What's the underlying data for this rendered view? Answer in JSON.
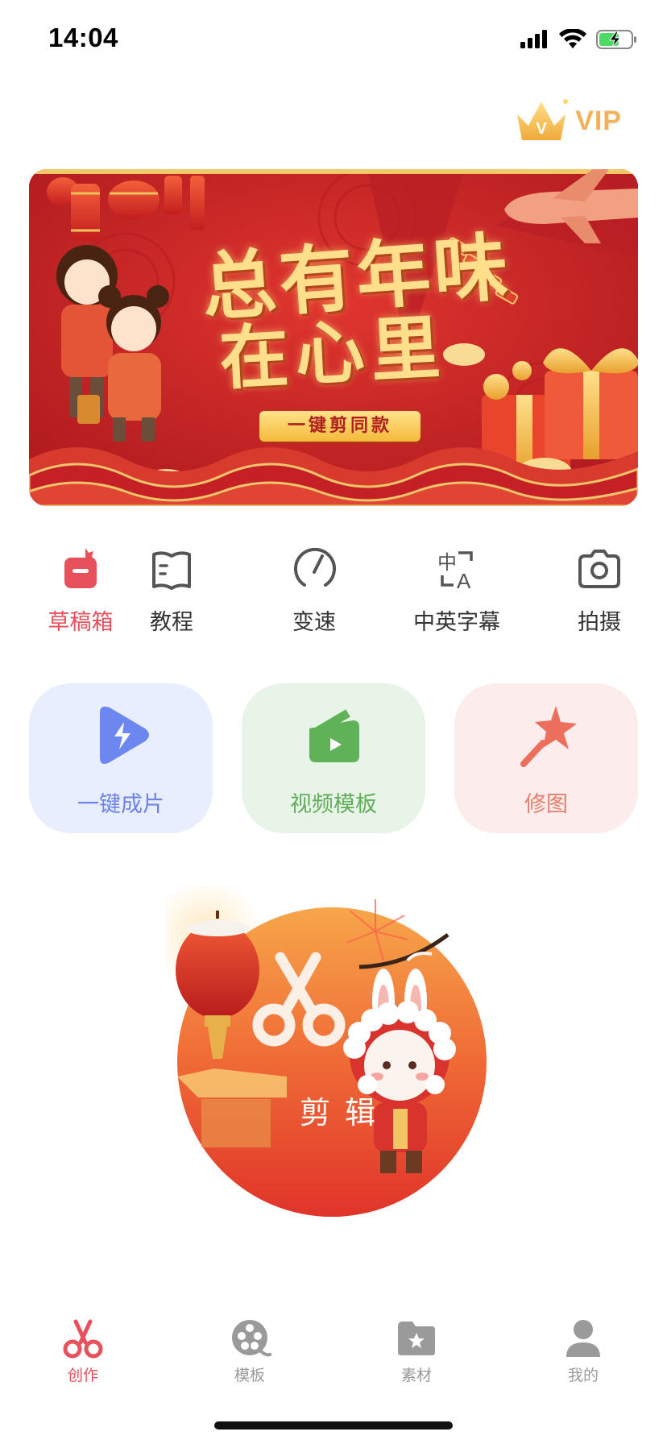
{
  "status_bar": {
    "time": "14:04",
    "icons": [
      "signal-icon",
      "wifi-icon",
      "battery-charging-icon"
    ]
  },
  "vip": {
    "label": "VIP",
    "icon": "crown-icon",
    "color": "#f1b25b"
  },
  "banner": {
    "title_line1": "总有年味",
    "title_line2": "在心里",
    "button_label": "一键剪同款"
  },
  "tools": [
    {
      "label": "草稿箱",
      "icon": "draft-box-icon",
      "active": true
    },
    {
      "label": "教程",
      "icon": "tutorial-book-icon",
      "active": false
    },
    {
      "label": "变速",
      "icon": "speed-gauge-icon",
      "active": false
    },
    {
      "label": "中英字幕",
      "icon": "subtitle-translate-icon",
      "active": false
    },
    {
      "label": "拍摄",
      "icon": "camera-icon",
      "active": false
    }
  ],
  "cards": [
    {
      "label": "一键成片",
      "icon": "one-click-video-icon",
      "color": "#6d83e6"
    },
    {
      "label": "视频模板",
      "icon": "video-template-icon",
      "color": "#62ad5c"
    },
    {
      "label": "修图",
      "icon": "photo-edit-wand-icon",
      "color": "#e67d6d"
    }
  ],
  "edit": {
    "label": "剪辑",
    "icon": "scissors-icon"
  },
  "tabbar": [
    {
      "label": "创作",
      "icon": "scissors-tab-icon",
      "active": true
    },
    {
      "label": "模板",
      "icon": "film-reel-icon",
      "active": false
    },
    {
      "label": "素材",
      "icon": "material-folder-icon",
      "active": false
    },
    {
      "label": "我的",
      "icon": "user-profile-icon",
      "active": false
    }
  ],
  "colors": {
    "accent": "#e8505b",
    "banner_red": "#c8242a",
    "inactive": "#9a9a9a"
  }
}
